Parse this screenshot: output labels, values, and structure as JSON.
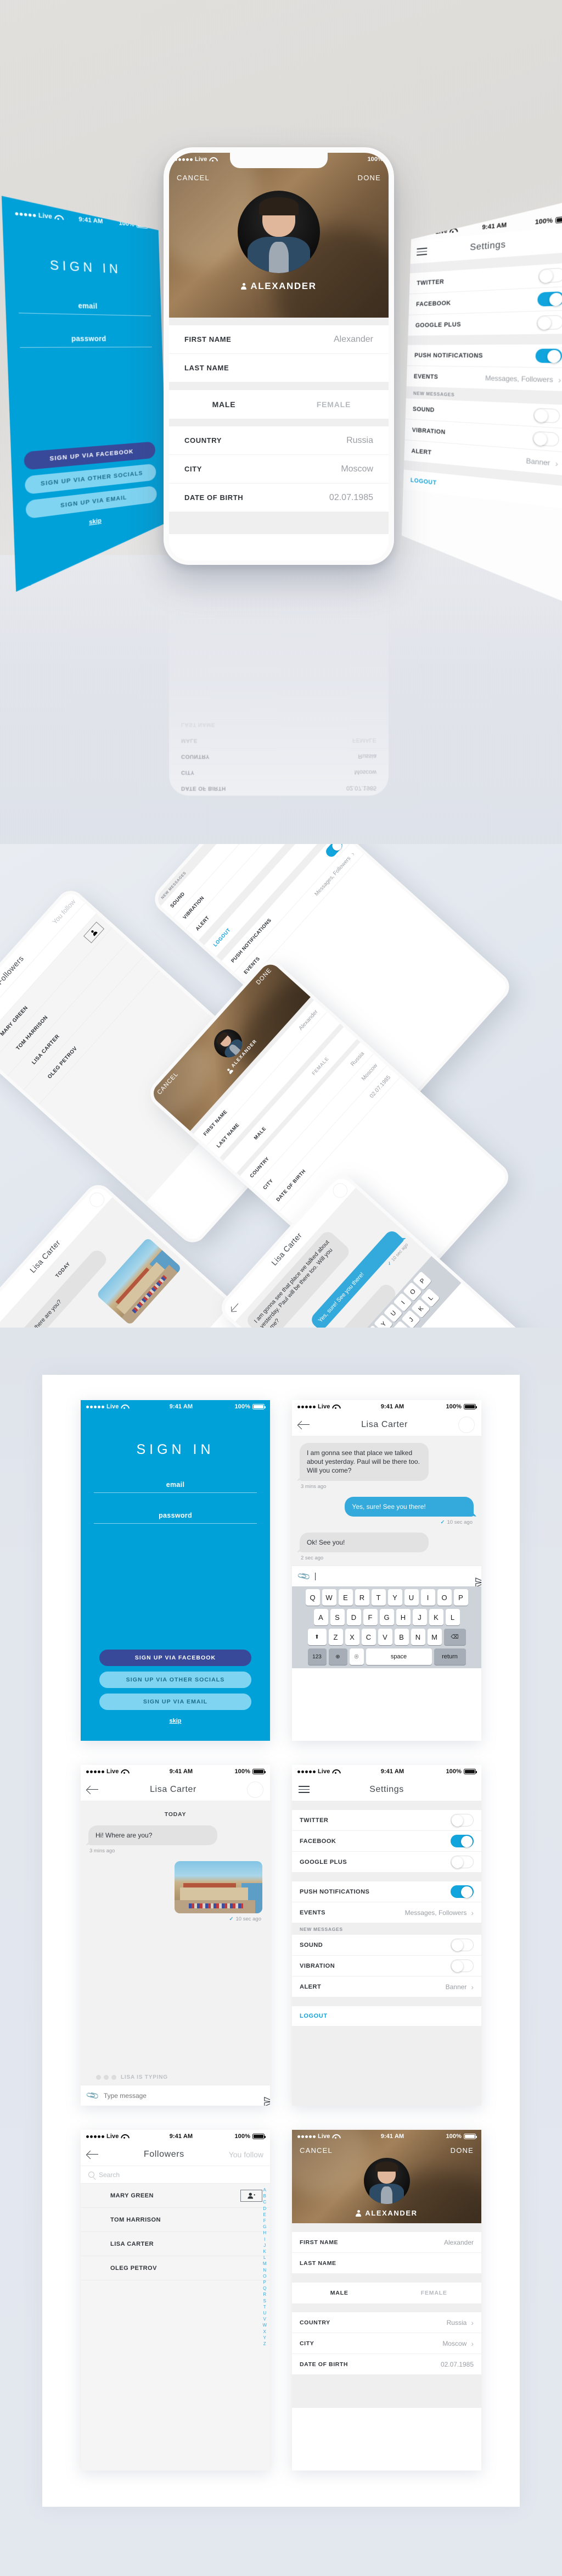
{
  "statusbar": {
    "carrier": "Live",
    "time": "9:41 AM",
    "battery": "100%"
  },
  "colors": {
    "brand_blue": "#00a0d8",
    "chat_blue": "#34a9dc",
    "facebook_blue": "#39499a",
    "light_blue": "#7fd4f2",
    "toggle_on": "#11a4dd",
    "accent_link": "#36a9dd"
  },
  "signin": {
    "title": "SIGN IN",
    "email_placeholder": "email",
    "password_placeholder": "password",
    "btn_facebook": "SIGN UP VIA FACEBOOK",
    "btn_socials": "SIGN UP VIA OTHER SOCIALS",
    "btn_email": "SIGN UP VIA EMAIL",
    "skip": "skip"
  },
  "chat": {
    "title": "Lisa Carter",
    "day_label": "TODAY",
    "messages": [
      {
        "dir": "in",
        "text": "I am gonna see that place we talked about yesterday. Paul will be there too. Will you come?",
        "time": "3 mins ago"
      },
      {
        "dir": "out",
        "text": "Yes, sure! See you there!",
        "time": "10 sec ago",
        "read": true
      },
      {
        "dir": "in",
        "text": "Ok! See you!",
        "time": "2 sec ago"
      }
    ],
    "composer_value": "",
    "composer_placeholder": "",
    "keyboard": {
      "row1": [
        "Q",
        "W",
        "E",
        "R",
        "T",
        "Y",
        "U",
        "I",
        "O",
        "P"
      ],
      "row2": [
        "A",
        "S",
        "D",
        "F",
        "G",
        "H",
        "J",
        "K",
        "L"
      ],
      "row3": [
        "Z",
        "X",
        "C",
        "V",
        "B",
        "N",
        "M"
      ],
      "shift": "⬆",
      "backspace": "⌫",
      "num": "123",
      "globe": "🌐",
      "mic": "🎤",
      "space": "space",
      "return": "return"
    }
  },
  "chat_photo": {
    "title": "Lisa Carter",
    "day_label": "TODAY",
    "messages": [
      {
        "dir": "in",
        "text": "Hi! Where are you?",
        "time": "3 mins ago"
      },
      {
        "dir": "out",
        "type": "photo",
        "time": "10 sec ago",
        "read": true
      }
    ],
    "typing_indicator": "LISA IS TYPING",
    "composer_placeholder": "Type message"
  },
  "settings": {
    "title": "Settings",
    "accounts": [
      {
        "label": "TWITTER",
        "type": "toggle",
        "value": false
      },
      {
        "label": "FACEBOOK",
        "type": "toggle",
        "value": true
      },
      {
        "label": "GOOGLE PLUS",
        "type": "toggle",
        "value": false
      }
    ],
    "notifications": [
      {
        "label": "PUSH NOTIFICATIONS",
        "type": "toggle",
        "value": true
      },
      {
        "label": "EVENTS",
        "type": "link",
        "value": "Messages, Followers"
      }
    ],
    "new_messages_header": "NEW MESSAGES",
    "new_messages": [
      {
        "label": "SOUND",
        "type": "toggle",
        "value": false
      },
      {
        "label": "VIBRATION",
        "type": "toggle",
        "value": false
      },
      {
        "label": "ALERT",
        "type": "link",
        "value": "Banner"
      }
    ],
    "logout": "LOGOUT"
  },
  "followers": {
    "title": "Followers",
    "tab_you_follow": "You follow",
    "search_placeholder": "Search",
    "people": [
      {
        "name": "MARY GREEN",
        "avatar": "av-mary",
        "following": false,
        "action": "add-user"
      },
      {
        "name": "TOM HARRISON",
        "avatar": "av-tom",
        "following": true
      },
      {
        "name": "LISA CARTER",
        "avatar": "av-lisa",
        "following": true
      },
      {
        "name": "OLEG PETROV",
        "avatar": "av-oleg",
        "following": true
      }
    ],
    "alphabet": [
      "A",
      "B",
      "C",
      "D",
      "E",
      "F",
      "G",
      "H",
      "I",
      "J",
      "K",
      "L",
      "M",
      "N",
      "O",
      "P",
      "Q",
      "R",
      "S",
      "T",
      "U",
      "V",
      "W",
      "X",
      "Y",
      "Z"
    ]
  },
  "profile": {
    "cancel": "CANCEL",
    "done": "DONE",
    "display_name": "ALEXANDER",
    "fields": [
      {
        "label": "FIRST NAME",
        "value": "Alexander",
        "chevron": false
      },
      {
        "label": "LAST NAME",
        "value": "",
        "chevron": false
      }
    ],
    "gender": {
      "male": "MALE",
      "female": "FEMALE",
      "selected": "MALE"
    },
    "location": [
      {
        "label": "COUNTRY",
        "value": "Russia",
        "chevron": true
      },
      {
        "label": "CITY",
        "value": "Moscow",
        "chevron": true
      },
      {
        "label": "DATE OF BIRTH",
        "value": "02.07.1985",
        "chevron": false
      }
    ]
  },
  "hero_reflection": [
    {
      "label": "DATE OF BIRTH",
      "value": "02.07.1985"
    },
    {
      "label": "CITY",
      "value": "Moscow"
    },
    {
      "label": "COUNTRY",
      "value": "Russia"
    },
    {
      "label": "MALE",
      "value": "FEMALE"
    },
    {
      "label": "LAST NAME",
      "value": ""
    }
  ]
}
